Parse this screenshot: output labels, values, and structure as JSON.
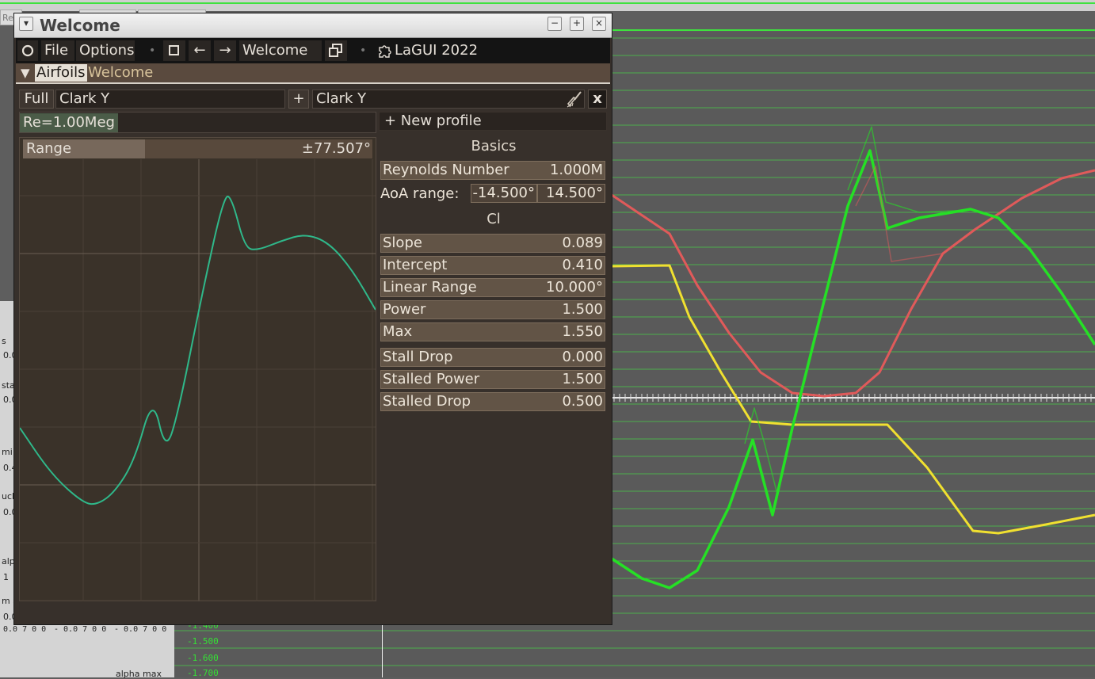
{
  "window": {
    "title": "Welcome",
    "controls": {
      "minimize": "−",
      "maximize": "+",
      "close": "×"
    }
  },
  "menubar": {
    "file": "File",
    "options": "Options",
    "nav_back": "←",
    "nav_forward": "→",
    "current_page": "Welcome",
    "app_name": "LaGUI 2022"
  },
  "tabs": {
    "collapse": "▼",
    "items": [
      "Airfoils",
      "Welcome"
    ]
  },
  "airfoil_toolbar": {
    "full_label": "Full",
    "left_profile": "Clark Y",
    "add_label": "+",
    "right_profile": "Clark Y",
    "close_label": "x"
  },
  "left_panel": {
    "reynolds_chip": "Re=1.00Meg",
    "range_label": "Range",
    "range_value": "±77.507°",
    "range_fill": 0.35
  },
  "right_panel": {
    "new_profile": "+  New profile",
    "basics_title": "Basics",
    "reynolds": {
      "label": "Reynolds Number",
      "value": "1.000M"
    },
    "aoa": {
      "label": "AoA range:",
      "min": "-14.500°",
      "max": "14.500°"
    },
    "cl_title": "Cl",
    "cl_props": [
      {
        "label": "Slope",
        "value": "0.089"
      },
      {
        "label": "Intercept",
        "value": "0.410"
      },
      {
        "label": "Linear Range",
        "value": "10.000°"
      },
      {
        "label": "Power",
        "value": "1.500"
      },
      {
        "label": "Max",
        "value": "1.550"
      }
    ],
    "stall_props": [
      {
        "label": "Stall Drop",
        "value": "0.000"
      },
      {
        "label": "Stalled Power",
        "value": "1.500"
      },
      {
        "label": "Stalled Drop",
        "value": "0.500"
      }
    ]
  },
  "background": {
    "axis_labels": [
      "-1.400",
      "-1.500",
      "-1.600",
      "-1.700"
    ],
    "bottom_label": "alpha max",
    "numboxes": [
      "0.0 7 0 0",
      "- 0.0 7 0 0",
      "- 0.0 7 0 0"
    ],
    "left_fragments": [
      "s",
      "0.0",
      "stal",
      "0.0",
      "mi",
      "0.4",
      "ucl",
      "0.0",
      "alp",
      "1",
      "m a",
      "0.0"
    ],
    "tab_fragment": "Re"
  },
  "colors": {
    "window_bg": "#37302b",
    "curve_teal": "#2fb88a",
    "bg_green": "#25e025",
    "bg_red": "#e05a5a",
    "bg_yellow": "#f0e030"
  }
}
